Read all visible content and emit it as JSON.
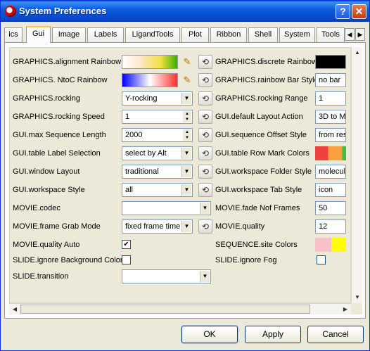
{
  "window": {
    "title": "System Preferences",
    "help": "?",
    "close": "✕"
  },
  "tabs": {
    "items": [
      "ics",
      "Gui",
      "Image",
      "Labels",
      "LigandTools",
      "Plot",
      "Ribbon",
      "Shell",
      "System",
      "Tools"
    ],
    "active": "Gui",
    "scroll_left": "◀",
    "scroll_right": "▶"
  },
  "colors": {
    "alignment_rainbow": [
      "#ffffff",
      "#ffe8d0",
      "#f2e040",
      "#38b000"
    ],
    "ntoc_rainbow": [
      "#0000ff",
      "#ffffff",
      "#ff3030"
    ],
    "discrete_rainbow": "#000000",
    "row_mark_colors": [
      "#f04040",
      "#f8a040",
      "#40c040"
    ],
    "site_colors": [
      "#f8c0c8",
      "#ffff00"
    ]
  },
  "left": {
    "alignment_rainbow": "GRAPHICS.alignment Rainbow",
    "ntoc_rainbow": "GRAPHICS. NtoC Rainbow",
    "rocking": "GRAPHICS.rocking",
    "rocking_value": "Y-rocking",
    "rocking_speed": "GRAPHICS.rocking Speed",
    "rocking_speed_value": "1",
    "max_seq_len": "GUI.max Sequence Length",
    "max_seq_len_value": "2000",
    "table_label_selection": "GUI.table Label Selection",
    "table_label_selection_value": "select by Alt",
    "window_layout": "GUI.window Layout",
    "window_layout_value": "traditional",
    "workspace_style": "GUI.workspace Style",
    "workspace_style_value": "all",
    "movie_codec": "MOVIE.codec",
    "movie_codec_value": "",
    "frame_grab": "MOVIE.frame Grab Mode",
    "frame_grab_value": "fixed frame time",
    "quality_auto": "MOVIE.quality Auto",
    "ignore_bg": "SLIDE.ignore Background Color",
    "transition": "SLIDE.transition",
    "transition_value": ""
  },
  "right": {
    "discrete_rainbow": "GRAPHICS.discrete Rainbow",
    "rainbow_bar_style": "GRAPHICS.rainbow Bar Style",
    "rainbow_bar_style_value": "no bar",
    "rocking_range": "GRAPHICS.rocking Range",
    "rocking_range_value": "1",
    "default_layout_action": "GUI.default Layout Action",
    "default_layout_action_value": "3D to M",
    "seq_offset_style": "GUI.sequence Offset Style",
    "seq_offset_style_value": "from res",
    "row_mark_colors": "GUI.table Row Mark Colors",
    "ws_folder_style": "GUI.workspace Folder Style",
    "ws_folder_style_value": "molecul",
    "ws_tab_style": "GUI.workspace Tab Style",
    "ws_tab_style_value": "icon",
    "fade_frames": "MOVIE.fade Nof Frames",
    "fade_frames_value": "50",
    "movie_quality": "MOVIE.quality",
    "movie_quality_value": "12",
    "site_colors": "SEQUENCE.site Colors",
    "ignore_fog": "SLIDE.ignore Fog"
  },
  "checks": {
    "quality_auto": true,
    "ignore_bg": false,
    "ignore_fog": false
  },
  "glyphs": {
    "check": "✔",
    "pencil": "✎",
    "reset": "⟲",
    "dropdown": "▼",
    "up": "▲",
    "down": "▼",
    "left": "◀",
    "right": "▶"
  },
  "buttons": {
    "ok": "OK",
    "apply": "Apply",
    "cancel": "Cancel"
  }
}
